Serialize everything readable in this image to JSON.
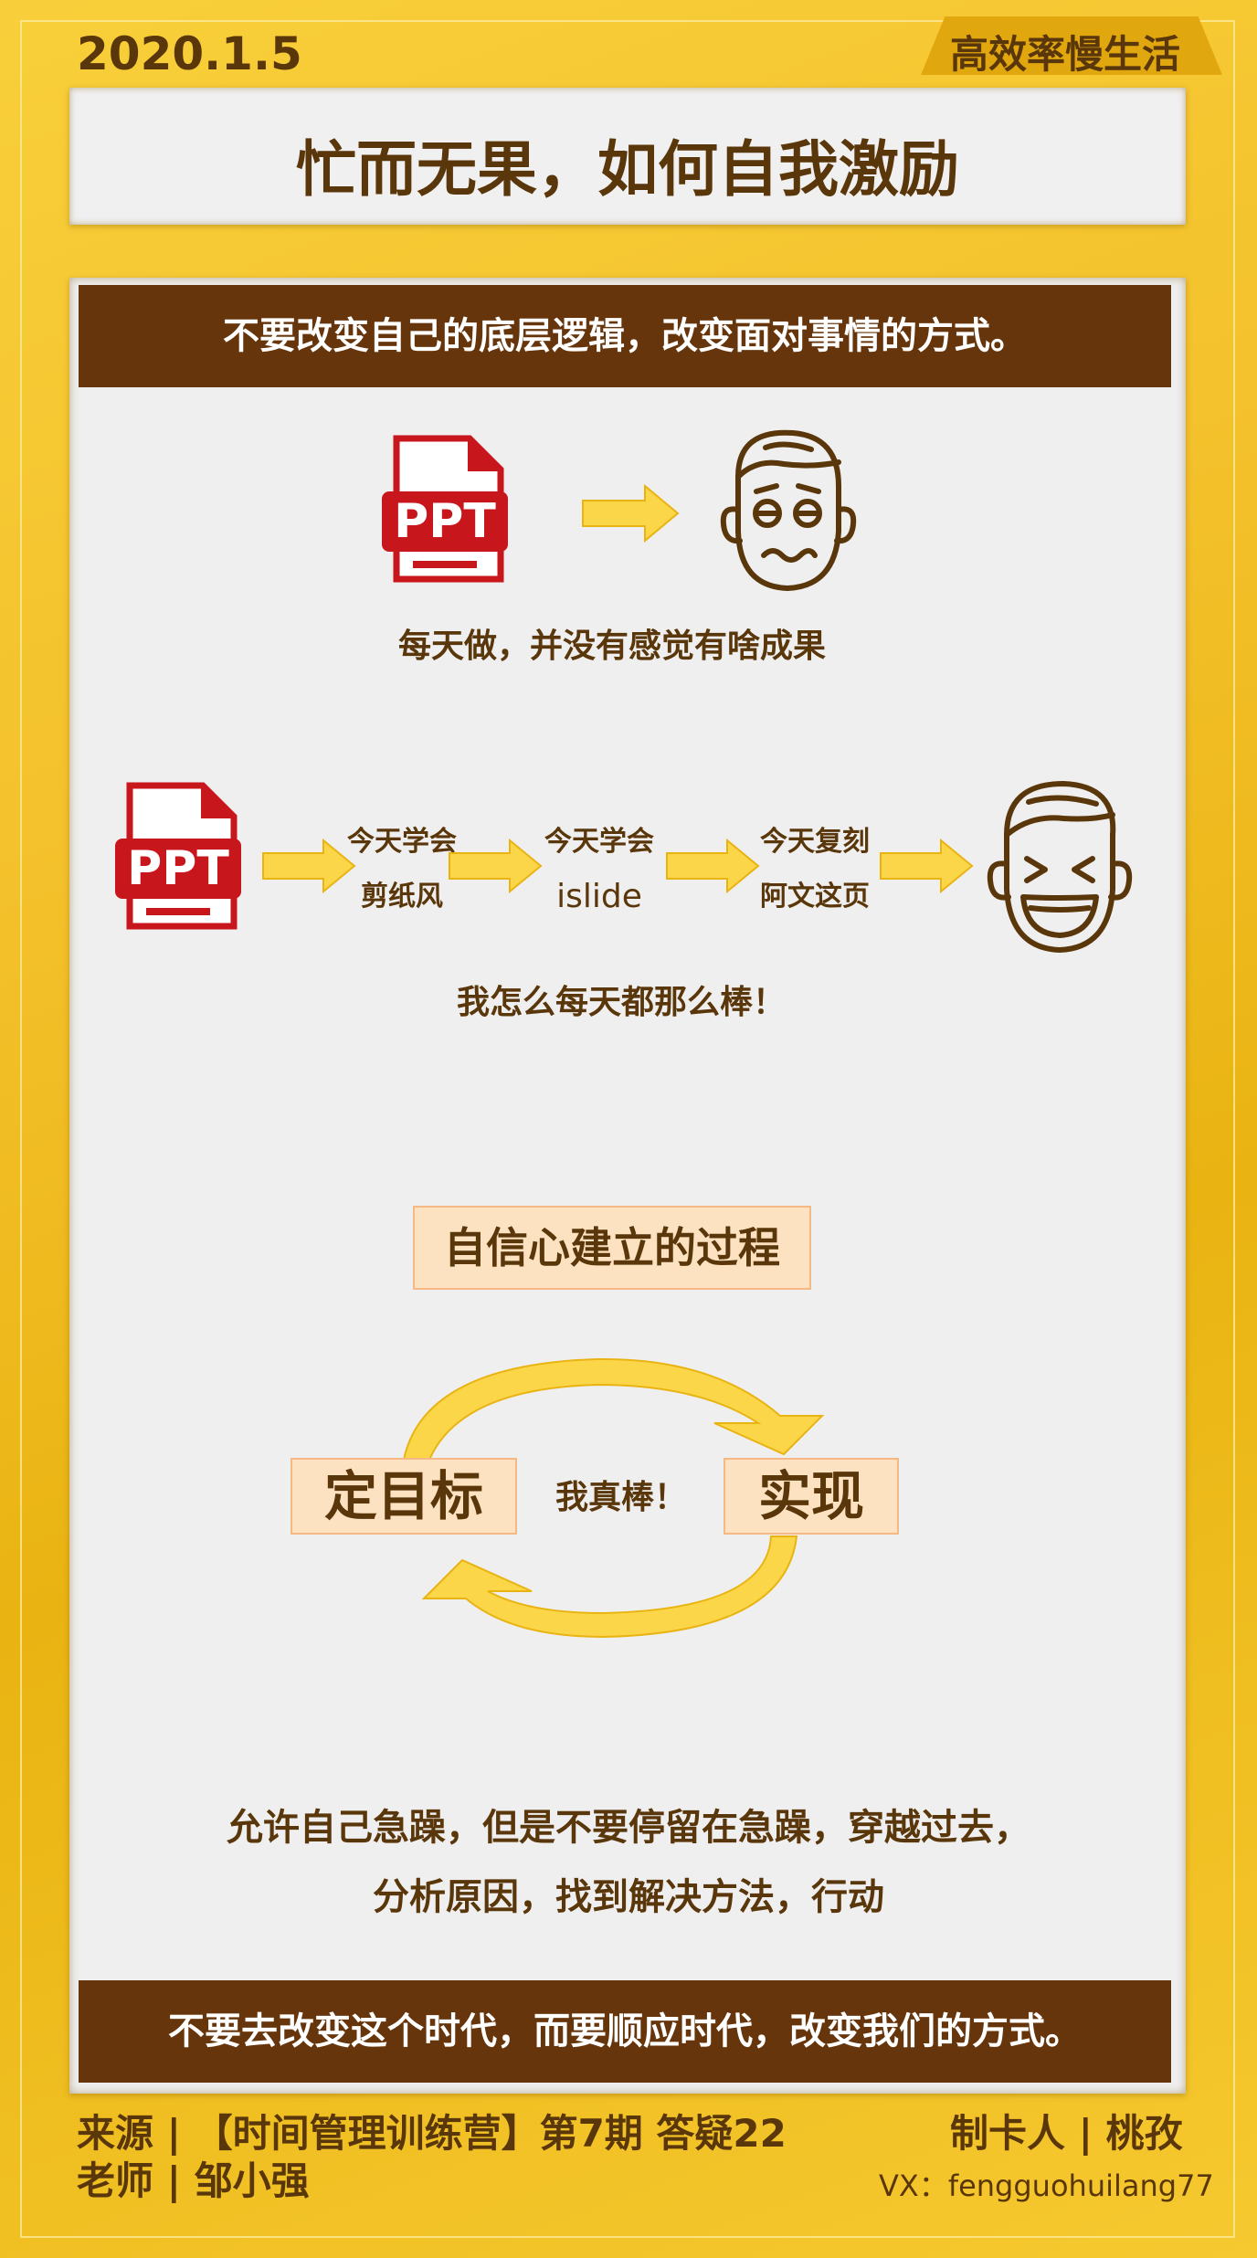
{
  "header": {
    "date": "2020.1.5",
    "brand": "高效率慢生活",
    "title": "忙而无果，如何自我激励"
  },
  "band_top": "不要改变自己的底层逻辑，改变面对事情的方式。",
  "section1": {
    "ppt_label": "PPT",
    "caption": "每天做，并没有感觉有啥成果"
  },
  "section2": {
    "ppt_label": "PPT",
    "steps": [
      {
        "line1": "今天学会",
        "line2": "剪纸风"
      },
      {
        "line1": "今天学会",
        "line2": "islide"
      },
      {
        "line1": "今天复刻",
        "line2": "阿文这页"
      }
    ],
    "caption": "我怎么每天都那么棒！"
  },
  "cycle": {
    "heading": "自信心建立的过程",
    "left": "定目标",
    "right": "实现",
    "center": "我真棒！"
  },
  "paragraph": {
    "line1": "允许自己急躁，但是不要停留在急躁，穿越过去，",
    "line2": "分析原因，找到解决方法，行动"
  },
  "band_bottom": "不要去改变这个时代，而要顺应时代，改变我们的方式。",
  "footer": {
    "source": "来源 | 【时间管理训练营】第7期  答疑22",
    "teacher": "老师 | 邹小强",
    "maker": "制卡人 | 桃孜",
    "vx": "VX：fengguohuilang77"
  },
  "colors": {
    "gold": "#f3c02a",
    "brown": "#66350b",
    "text_brown": "#5a360b",
    "arrow_yellow": "#fbd649",
    "ppt_red": "#c8161d",
    "box_peach": "#fde2c1"
  },
  "icons": [
    "ppt-file-icon",
    "arrow-right-icon",
    "worried-face-icon",
    "laughing-face-icon",
    "cycle-arrow-icon"
  ]
}
